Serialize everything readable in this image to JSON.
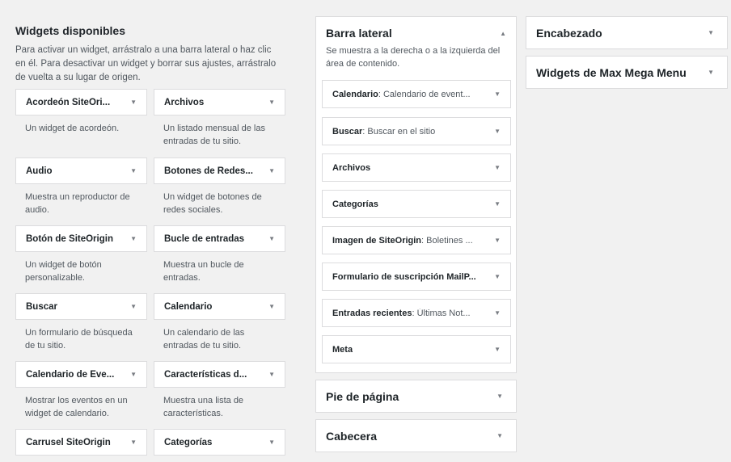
{
  "available": {
    "title": "Widgets disponibles",
    "description": "Para activar un widget, arrástralo a una barra lateral o haz clic en él. Para desactivar un widget y borrar sus ajustes, arrástralo de vuelta a su lugar de origen.",
    "widgets": [
      {
        "name": "Acordeón SiteOri...",
        "desc": "Un widget de acordeón."
      },
      {
        "name": "Archivos",
        "desc": "Un listado mensual de las entradas de tu sitio."
      },
      {
        "name": "Audio",
        "desc": "Muestra un reproductor de audio."
      },
      {
        "name": "Botones de Redes...",
        "desc": "Un widget de botones de redes sociales."
      },
      {
        "name": "Botón de SiteOrigin",
        "desc": "Un widget de botón personalizable."
      },
      {
        "name": "Bucle de entradas",
        "desc": "Muestra un bucle de entradas."
      },
      {
        "name": "Buscar",
        "desc": "Un formulario de búsqueda de tu sitio."
      },
      {
        "name": "Calendario",
        "desc": "Un calendario de las entradas de tu sitio."
      },
      {
        "name": "Calendario de Eve...",
        "desc": "Mostrar los eventos en un widget de calendario."
      },
      {
        "name": "Características d...",
        "desc": "Muestra una lista de características."
      },
      {
        "name": "Carrusel SiteOrigin",
        "desc": ""
      },
      {
        "name": "Categorías",
        "desc": ""
      }
    ]
  },
  "sidebar": {
    "title": "Barra lateral",
    "description": "Se muestra a la derecha o a la izquierda del área de contenido.",
    "items": [
      {
        "type": "Calendario",
        "title": "Calendario de event..."
      },
      {
        "type": "Buscar",
        "title": "Buscar en el sitio"
      },
      {
        "type": "Archivos",
        "title": ""
      },
      {
        "type": "Categorías",
        "title": ""
      },
      {
        "type": "Imagen de SiteOrigin",
        "title": "Boletines ..."
      },
      {
        "type": "Formulario de suscripción MailP...",
        "title": ""
      },
      {
        "type": "Entradas recientes",
        "title": "Últimas Not..."
      },
      {
        "type": "Meta",
        "title": ""
      }
    ]
  },
  "areas": {
    "footer": "Pie de página",
    "header_es": "Cabecera",
    "encabezado": "Encabezado",
    "maxmega": "Widgets de Max Mega Menu"
  },
  "icons": {
    "expand": "chevron-down-icon",
    "collapse": "chevron-up-icon"
  }
}
